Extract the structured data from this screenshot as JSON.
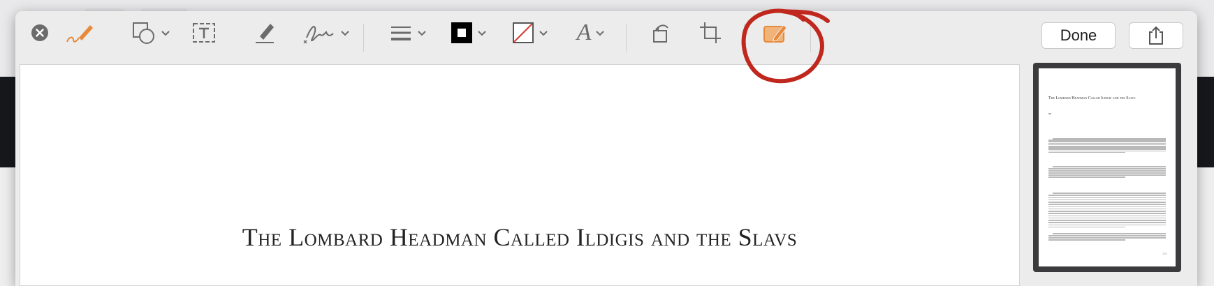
{
  "toolbar": {
    "done_label": "Done",
    "tools": [
      {
        "name": "close"
      },
      {
        "name": "sketch"
      },
      {
        "name": "shapes"
      },
      {
        "name": "text"
      },
      {
        "name": "highlight"
      },
      {
        "name": "sign"
      },
      {
        "name": "line-style"
      },
      {
        "name": "border-color"
      },
      {
        "name": "fill-color"
      },
      {
        "name": "text-style"
      },
      {
        "name": "rotate"
      },
      {
        "name": "crop"
      },
      {
        "name": "annotate"
      },
      {
        "name": "share"
      }
    ]
  },
  "document": {
    "title": "The Lombard Headman Called Ildigis and the Slavs"
  },
  "thumbnail": {
    "title": "The Lombard Headman Called Ildigis and the Slavs",
    "page_number": "227"
  },
  "colors": {
    "accent_orange": "#e8893a",
    "annotation_red": "#c0281e",
    "toolbar_bg": "#ececec"
  }
}
